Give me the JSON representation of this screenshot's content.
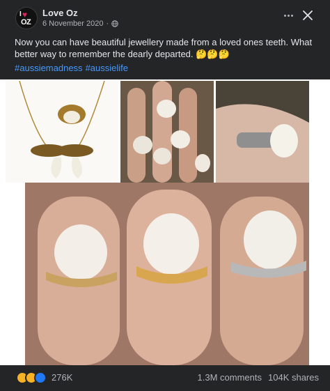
{
  "page": {
    "name": "Love Oz",
    "logo_text_top": "I",
    "logo_text_bottom": "OZ",
    "date": "6 November 2020",
    "separator": "·"
  },
  "post": {
    "text": "Now you can have beautiful jewellery made from a loved ones teeth. What better way to remember the dearly departed.  🤔🤔🤔",
    "hashtags": [
      "#aussiemadness",
      "#aussielife"
    ]
  },
  "footer": {
    "reaction_count": "276K",
    "comments": "1.3M comments",
    "shares": "104K shares"
  },
  "icons": {
    "more": "more-options-icon",
    "close": "close-icon",
    "privacy": "globe-icon"
  },
  "colors": {
    "background": "#242526",
    "text": "#e4e6eb",
    "muted": "#b0b3b8",
    "hashtag": "#4599ff"
  }
}
